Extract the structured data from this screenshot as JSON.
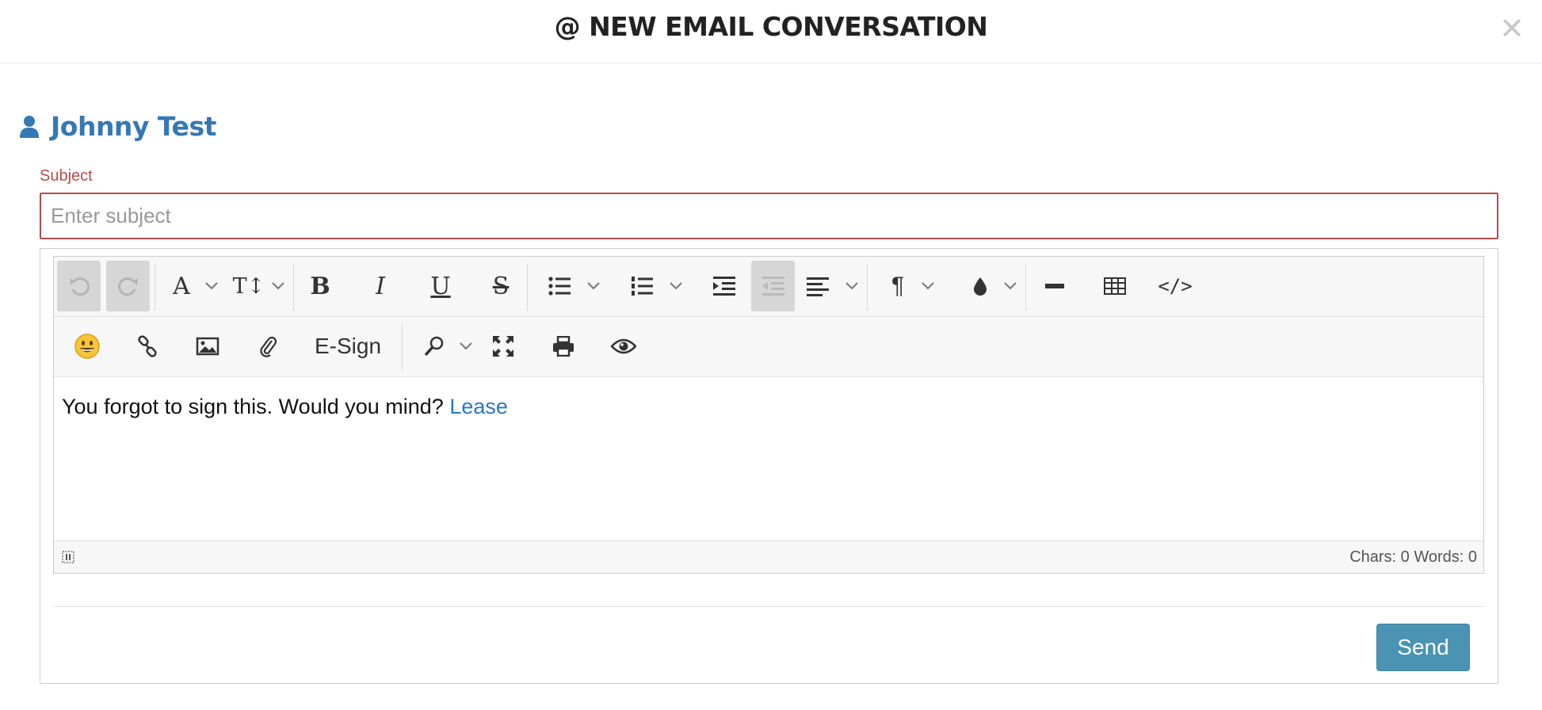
{
  "dialog": {
    "title": "@ NEW EMAIL CONVERSATION",
    "close_icon": "close-icon"
  },
  "contact": {
    "name": "Johnny Test",
    "icon": "user-icon",
    "color": "#3578b5"
  },
  "subject": {
    "label": "Subject",
    "placeholder": "Enter subject",
    "value": "",
    "error_color": "#b94a48"
  },
  "toolbar": {
    "row1": [
      "undo-icon",
      "redo-icon",
      "font-family-icon",
      "font-size-icon",
      "bold-icon",
      "italic-icon",
      "underline-icon",
      "strikethrough-icon",
      "bullet-list-icon",
      "numbered-list-icon",
      "indent-icon",
      "outdent-icon",
      "align-icon",
      "paragraph-format-icon",
      "color-drop-icon",
      "horizontal-rule-icon",
      "table-icon",
      "code-view-icon"
    ],
    "row2": [
      "emoji-icon",
      "link-icon",
      "image-icon",
      "attachment-icon",
      "search-icon",
      "fullscreen-icon",
      "print-icon",
      "preview-icon"
    ],
    "esign_label": "E-Sign"
  },
  "editor": {
    "body_text": "You forgot to sign this. Would you mind?",
    "link_text": "Lease",
    "link_color": "#2a75c8"
  },
  "status": {
    "counts": "Chars: 0   Words: 0"
  },
  "actions": {
    "send_label": "Send",
    "send_color": "#4a93b3"
  }
}
